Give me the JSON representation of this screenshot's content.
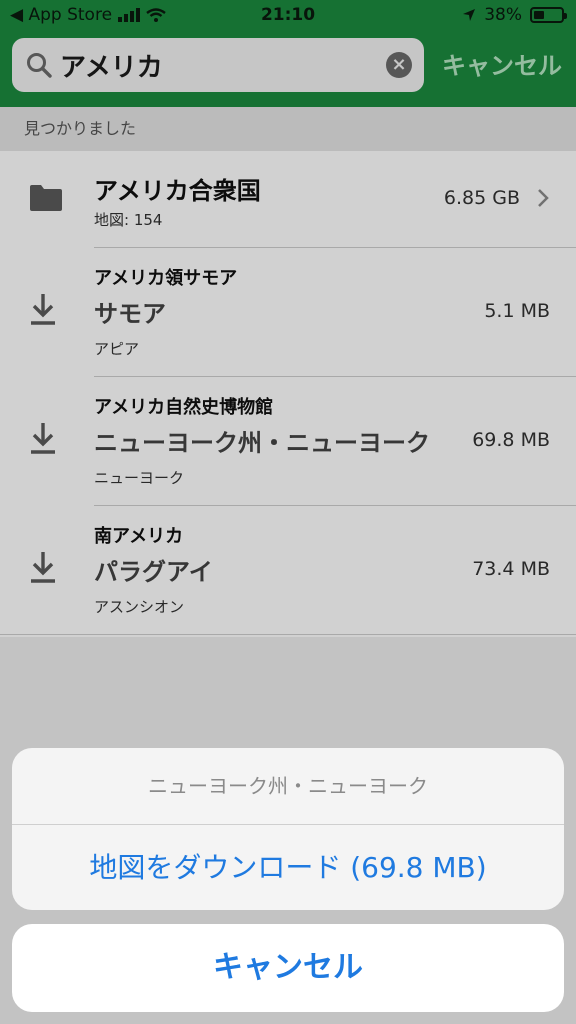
{
  "status": {
    "back_label": "◀ App Store",
    "time": "21:10",
    "battery": "38%",
    "battery_level": 0.38
  },
  "search": {
    "value": "アメリカ",
    "cancel_label": "キャンセル"
  },
  "section": {
    "label": "見つかりました"
  },
  "results": [
    {
      "title": "アメリカ合衆国",
      "subtitle": "地図: 154",
      "size": "6.85 GB",
      "type": "folder"
    },
    {
      "top": "アメリカ領サモア",
      "title": "サモア",
      "subtitle": "アピア",
      "size": "5.1 MB",
      "type": "download"
    },
    {
      "top": "アメリカ自然史博物館",
      "title": "ニューヨーク州・ニューヨーク",
      "subtitle": "ニューヨーク",
      "size": "69.8 MB",
      "type": "download"
    },
    {
      "top": "南アメリカ",
      "title": "パラグアイ",
      "subtitle": "アスンシオン",
      "size": "73.4 MB",
      "type": "download"
    }
  ],
  "sheet": {
    "title": "ニューヨーク州・ニューヨーク",
    "action_label": "地図をダウンロード (69.8 MB)",
    "cancel_label": "キャンセル"
  },
  "colors": {
    "header": "#1b8a3f",
    "action_blue": "#1f7ae0"
  }
}
